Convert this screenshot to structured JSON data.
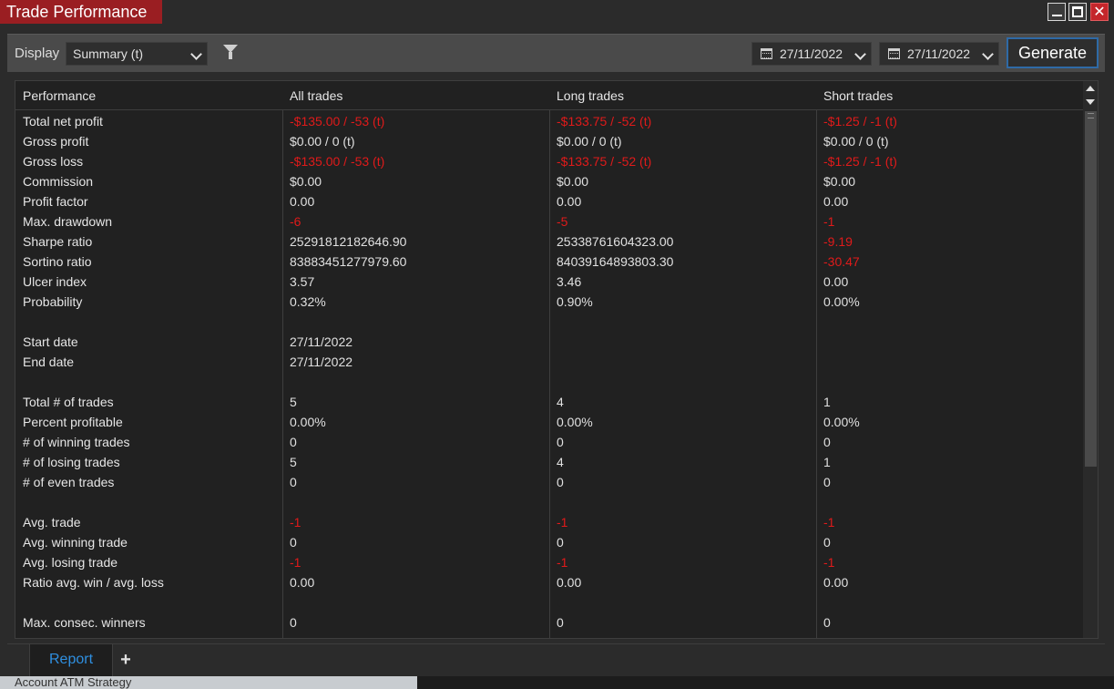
{
  "window": {
    "title": "Trade Performance",
    "buttons": {
      "minimize": "minimize-icon",
      "maximize": "maximize-icon",
      "close": "close-icon"
    }
  },
  "toolbar": {
    "display_label": "Display",
    "display_value": "Summary (t)",
    "from_date": "27/11/2022",
    "to_date": "27/11/2022",
    "generate_label": "Generate"
  },
  "table": {
    "headers": [
      "Performance",
      "All trades",
      "Long trades",
      "Short trades"
    ],
    "rows": [
      {
        "label": "Total net profit",
        "values": [
          "-$135.00 / -53 (t)",
          "-$133.75 / -52 (t)",
          "-$1.25 / -1 (t)"
        ],
        "neg": [
          true,
          true,
          true
        ]
      },
      {
        "label": "Gross profit",
        "values": [
          "$0.00 / 0 (t)",
          "$0.00 / 0 (t)",
          "$0.00 / 0 (t)"
        ],
        "neg": [
          false,
          false,
          false
        ]
      },
      {
        "label": "Gross loss",
        "values": [
          "-$135.00 / -53 (t)",
          "-$133.75 / -52 (t)",
          "-$1.25 / -1 (t)"
        ],
        "neg": [
          true,
          true,
          true
        ]
      },
      {
        "label": "Commission",
        "values": [
          "$0.00",
          "$0.00",
          "$0.00"
        ],
        "neg": [
          false,
          false,
          false
        ]
      },
      {
        "label": "Profit factor",
        "values": [
          "0.00",
          "0.00",
          "0.00"
        ],
        "neg": [
          false,
          false,
          false
        ]
      },
      {
        "label": "Max. drawdown",
        "values": [
          "-6",
          "-5",
          "-1"
        ],
        "neg": [
          true,
          true,
          true
        ]
      },
      {
        "label": "Sharpe ratio",
        "values": [
          "25291812182646.90",
          "25338761604323.00",
          "-9.19"
        ],
        "neg": [
          false,
          false,
          true
        ]
      },
      {
        "label": "Sortino ratio",
        "values": [
          "83883451277979.60",
          "84039164893803.30",
          "-30.47"
        ],
        "neg": [
          false,
          false,
          true
        ]
      },
      {
        "label": "Ulcer index",
        "values": [
          "3.57",
          "3.46",
          "0.00"
        ],
        "neg": [
          false,
          false,
          false
        ]
      },
      {
        "label": "Probability",
        "values": [
          "0.32%",
          "0.90%",
          "0.00%"
        ],
        "neg": [
          false,
          false,
          false
        ]
      },
      {
        "label": "",
        "values": [
          "",
          "",
          ""
        ],
        "neg": [
          false,
          false,
          false
        ]
      },
      {
        "label": "Start date",
        "values": [
          "27/11/2022",
          "",
          ""
        ],
        "neg": [
          false,
          false,
          false
        ]
      },
      {
        "label": "End date",
        "values": [
          "27/11/2022",
          "",
          ""
        ],
        "neg": [
          false,
          false,
          false
        ]
      },
      {
        "label": "",
        "values": [
          "",
          "",
          ""
        ],
        "neg": [
          false,
          false,
          false
        ]
      },
      {
        "label": "Total # of trades",
        "values": [
          "5",
          "4",
          "1"
        ],
        "neg": [
          false,
          false,
          false
        ]
      },
      {
        "label": "Percent profitable",
        "values": [
          "0.00%",
          "0.00%",
          "0.00%"
        ],
        "neg": [
          false,
          false,
          false
        ]
      },
      {
        "label": "# of winning trades",
        "values": [
          "0",
          "0",
          "0"
        ],
        "neg": [
          false,
          false,
          false
        ]
      },
      {
        "label": "# of losing trades",
        "values": [
          "5",
          "4",
          "1"
        ],
        "neg": [
          false,
          false,
          false
        ]
      },
      {
        "label": "# of even trades",
        "values": [
          "0",
          "0",
          "0"
        ],
        "neg": [
          false,
          false,
          false
        ]
      },
      {
        "label": "",
        "values": [
          "",
          "",
          ""
        ],
        "neg": [
          false,
          false,
          false
        ]
      },
      {
        "label": "Avg. trade",
        "values": [
          "-1",
          "-1",
          "-1"
        ],
        "neg": [
          true,
          true,
          true
        ]
      },
      {
        "label": "Avg. winning trade",
        "values": [
          "0",
          "0",
          "0"
        ],
        "neg": [
          false,
          false,
          false
        ]
      },
      {
        "label": "Avg. losing trade",
        "values": [
          "-1",
          "-1",
          "-1"
        ],
        "neg": [
          true,
          true,
          true
        ]
      },
      {
        "label": "Ratio avg. win / avg. loss",
        "values": [
          "0.00",
          "0.00",
          "0.00"
        ],
        "neg": [
          false,
          false,
          false
        ]
      },
      {
        "label": "",
        "values": [
          "",
          "",
          ""
        ],
        "neg": [
          false,
          false,
          false
        ]
      },
      {
        "label": "Max. consec. winners",
        "values": [
          "0",
          "0",
          "0"
        ],
        "neg": [
          false,
          false,
          false
        ]
      }
    ]
  },
  "tabs": [
    {
      "label": "Report"
    }
  ],
  "add_tab_label": "+",
  "background_strip": {
    "left_text": "Account        ATM Strategy"
  },
  "colors": {
    "title_bg": "#9a1e22",
    "negative": "#e01a1a",
    "accent": "#2f8fe0",
    "generate_border": "#2f6aa6"
  }
}
